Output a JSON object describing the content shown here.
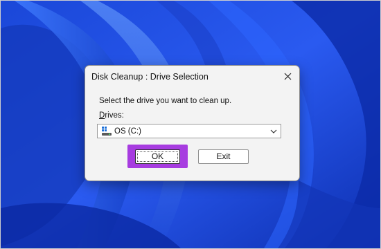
{
  "dialog": {
    "title": "Disk Cleanup : Drive Selection",
    "prompt": "Select the drive you want to clean up.",
    "drives_label_mnemonic": "D",
    "drives_label_rest": "rives:",
    "selected_drive": "OS (C:)",
    "ok_label": "OK",
    "exit_label": "Exit"
  },
  "icons": {
    "close": "close-icon",
    "drive": "drive-icon",
    "dropdown": "chevron-down-icon"
  },
  "colors": {
    "wallpaper_blue": "#1f4fe0",
    "highlight_purple": "#a73ce0",
    "dialog_bg": "#f3f3f3"
  }
}
